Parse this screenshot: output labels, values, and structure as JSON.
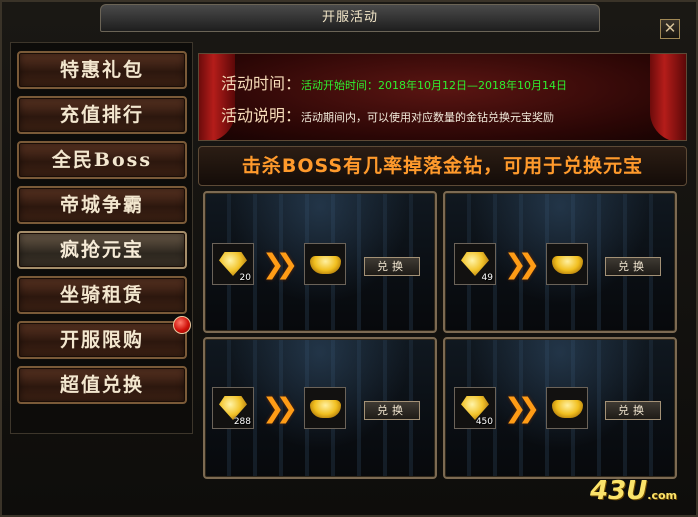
{
  "window": {
    "title": "开服活动",
    "close_glyph": "✕"
  },
  "sidebar": {
    "items": [
      {
        "label": "特惠礼包",
        "active": false
      },
      {
        "label": "充值排行",
        "active": false
      },
      {
        "label": "全民Boss",
        "active": false
      },
      {
        "label": "帝城争霸",
        "active": false
      },
      {
        "label": "疯抢元宝",
        "active": true
      },
      {
        "label": "坐骑租赁",
        "active": false
      },
      {
        "label": "开服限购",
        "active": false,
        "badge": true
      },
      {
        "label": "超值兑换",
        "active": false
      }
    ]
  },
  "banner": {
    "time_label": "活动时间：",
    "time_value": "活动开始时间：2018年10月12日—2018年10月14日",
    "desc_label": "活动说明：",
    "desc_value": "活动期间内，可以使用对应数量的金钻兑换元宝奖励"
  },
  "headline": "击杀BOSS有几率掉落金钻，可用于兑换元宝",
  "exchanges": [
    {
      "cost": "20",
      "reward_icon": "gold-ingot-icon",
      "button": "兑换"
    },
    {
      "cost": "49",
      "reward_icon": "gold-ingot-icon",
      "button": "兑换"
    },
    {
      "cost": "288",
      "reward_icon": "gold-ingot-icon",
      "button": "兑换"
    },
    {
      "cost": "450",
      "reward_icon": "gold-ingot-icon",
      "button": "兑换"
    }
  ],
  "watermark": {
    "text": "43U",
    "suffix": ".com"
  },
  "colors": {
    "accent_orange": "#ff9a2c",
    "time_green": "#2ff02f",
    "badge_red": "#d0120a"
  }
}
